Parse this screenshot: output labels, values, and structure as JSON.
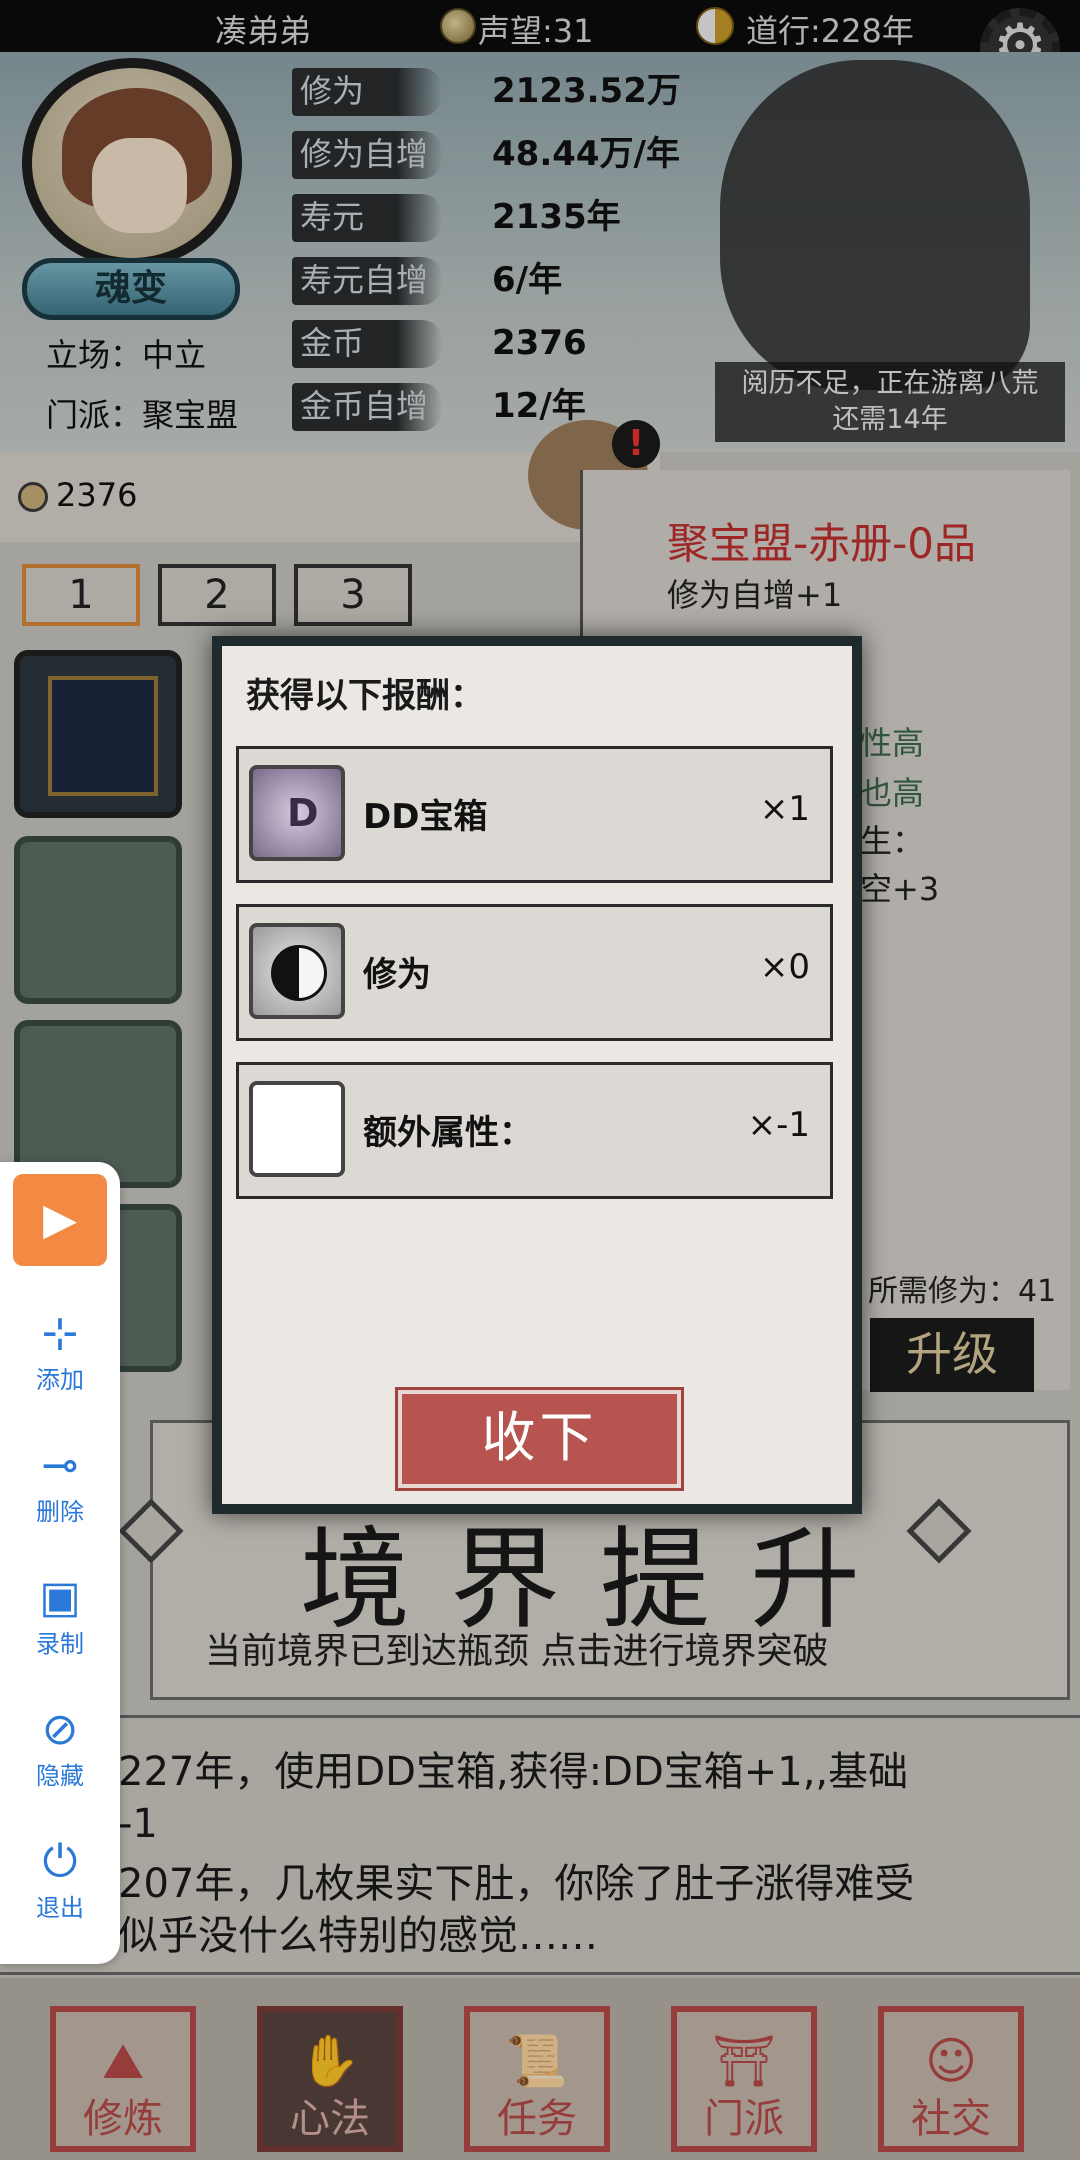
{
  "topbar": {
    "player_name": "凑弟弟",
    "reputation": "声望:31",
    "dao": "道行:228年"
  },
  "profile": {
    "badge": "魂变",
    "stance": "立场：中立",
    "sect": "门派：聚宝盟"
  },
  "stats": [
    {
      "label": "修为",
      "value": "2123.52万"
    },
    {
      "label": "修为自增",
      "value": "48.44万/年"
    },
    {
      "label": "寿元",
      "value": "2135年"
    },
    {
      "label": "寿元自增",
      "value": "6/年"
    },
    {
      "label": "金币",
      "value": "2376"
    },
    {
      "label": "金币自增",
      "value": "12/年"
    }
  ],
  "wander": {
    "line1": "阅历不足，正在游离八荒",
    "line2": "还需14年"
  },
  "inventory": {
    "coins": "2376",
    "tabs": [
      "1",
      "2",
      "3"
    ],
    "active_tab": 0
  },
  "detail": {
    "title": "聚宝盟-赤册-0品",
    "effect": "修为自增+1",
    "green1": "性高",
    "green2": "也高",
    "line3": "生：",
    "line4": "空+3",
    "required": "所需修为：41",
    "upgrade": "升级",
    "marker": "1"
  },
  "realm": {
    "big": "境界提升",
    "sub": "当前境界已到达瓶颈 点击进行境界突破"
  },
  "log": [
    "历227年，使用DD宝箱,获得:DD宝箱+1,,基础",
    "元-1",
    "历207年，几枚果实下肚，你除了肚子涨得难受",
    "外似乎没什么特别的感觉……"
  ],
  "nav": [
    {
      "label": "修炼",
      "icon": "⛰"
    },
    {
      "label": "心法",
      "icon": "✋"
    },
    {
      "label": "任务",
      "icon": "📜"
    },
    {
      "label": "门派",
      "icon": "⛩"
    },
    {
      "label": "社交",
      "icon": "☺"
    }
  ],
  "nav_active": 1,
  "dialog": {
    "title": "获得以下报酬：",
    "rewards": [
      {
        "name": "DD宝箱",
        "qty": "×1",
        "icon": "chest-icon"
      },
      {
        "name": "修为",
        "qty": "×0",
        "icon": "taiji-icon"
      },
      {
        "name": "额外属性：",
        "qty": "×-1",
        "icon": "blank-icon"
      }
    ],
    "accept": "收下"
  },
  "toolbar": {
    "play_icon": "▶",
    "items": [
      {
        "label": "添加",
        "icon": "⊹"
      },
      {
        "label": "删除",
        "icon": "⊸"
      },
      {
        "label": "录制",
        "icon": "▣"
      },
      {
        "label": "隐藏",
        "icon": "⊘"
      },
      {
        "label": "退出",
        "icon": "⏻"
      }
    ]
  },
  "colors": {
    "accent_red": "#b85450",
    "title_red": "#c0302e",
    "toolbar_orange": "#f28a44",
    "toolbar_blue": "#2a78d8"
  }
}
